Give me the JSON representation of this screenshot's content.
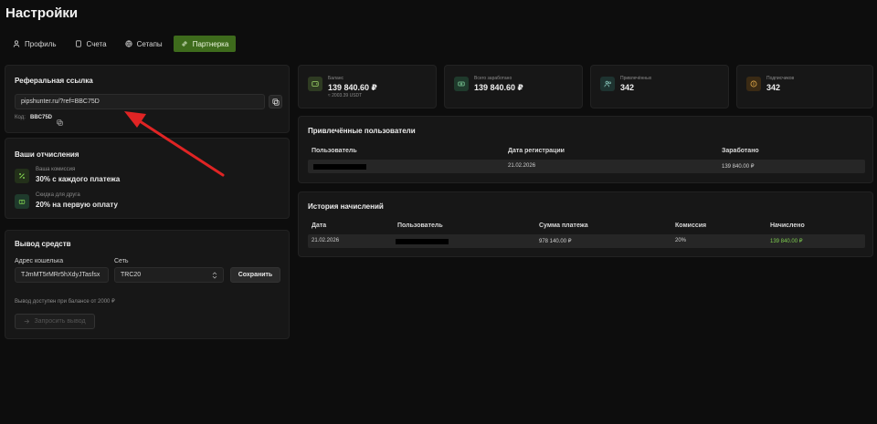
{
  "header": {
    "title": "Настройки"
  },
  "tabs": [
    {
      "label": "Профиль",
      "icon": "user-icon"
    },
    {
      "label": "Счета",
      "icon": "file-icon"
    },
    {
      "label": "Сетапы",
      "icon": "globe-icon"
    },
    {
      "label": "Партнерка",
      "icon": "link-icon",
      "active": true
    }
  ],
  "referral": {
    "title": "Реферальная ссылка",
    "link": "pipshunter.ru/?ref=BBC75D",
    "code_label": "Код:",
    "code": "BBC75D"
  },
  "payouts": {
    "title": "Ваши отчисления",
    "commission_label": "Ваша комиссия",
    "commission_value": "30% с каждого платежа",
    "discount_label": "Скидка для друга",
    "discount_value": "20% на первую оплату"
  },
  "withdraw": {
    "title": "Вывод средств",
    "wallet_label": "Адрес кошелька",
    "wallet_value": "TJmMT5rMRr5hXdyJTasfsx",
    "network_label": "Сеть",
    "network_value": "TRC20",
    "save_label": "Сохранить",
    "notice": "Вывод доступен при балансе от 2000 ₽",
    "request_label": "Запросить вывод"
  },
  "stats": [
    {
      "label": "Баланс",
      "value": "139 840.60 ₽",
      "sub": "≈ 2003.39 USDT",
      "icon": "wallet-icon",
      "color": "#2e3b22"
    },
    {
      "label": "Всего заработано",
      "value": "139 840.60 ₽",
      "sub": "",
      "icon": "cash-icon",
      "color": "#1f3a2c"
    },
    {
      "label": "Привлечённых",
      "value": "342",
      "sub": "",
      "icon": "users-icon",
      "color": "#1e3330"
    },
    {
      "label": "Подписчиков",
      "value": "342",
      "sub": "",
      "icon": "coin-icon",
      "color": "#3a2a14"
    }
  ],
  "referred_users": {
    "title": "Привлечённые пользователи",
    "columns": [
      "Пользователь",
      "Дата регистрации",
      "Заработано"
    ],
    "rows": [
      {
        "user": "",
        "date": "21.02.2026",
        "earned": "139 840.00 ₽"
      }
    ]
  },
  "history": {
    "title": "История начислений",
    "columns": [
      "Дата",
      "Пользователь",
      "Сумма платежа",
      "Комиссия",
      "Начислено"
    ],
    "rows": [
      {
        "date": "21.02.2026",
        "user": "",
        "amount": "978 140.00 ₽",
        "commission": "20%",
        "credited": "139 840.00 ₽"
      }
    ]
  },
  "colors": {
    "accent": "#3e6b1c",
    "positive": "#7fce4f",
    "arrow": "#e02424"
  }
}
